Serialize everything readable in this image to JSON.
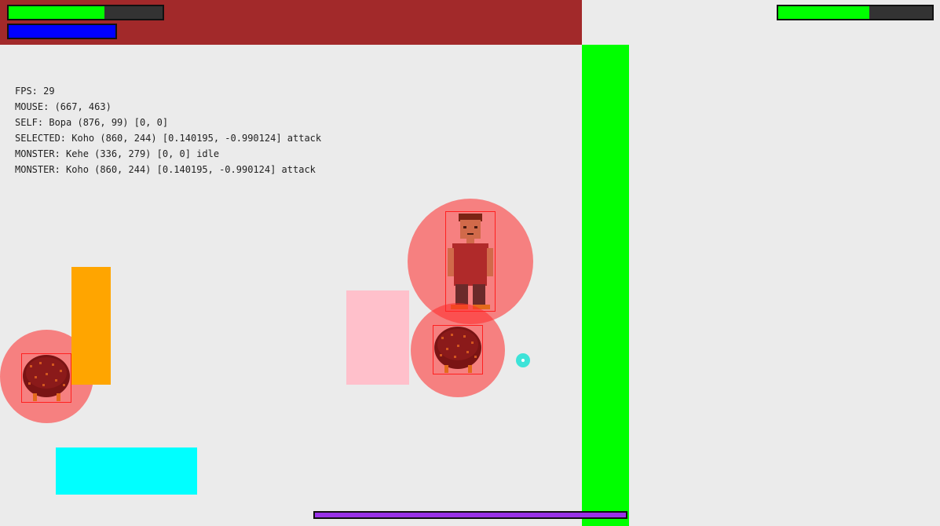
{
  "hud": {
    "player_health": 0.62,
    "player_mana": 1.0,
    "target_health": 0.59,
    "cast_progress": 1.0,
    "colors": {
      "banner": "#a2292a",
      "health": "#00ff00",
      "mana": "#0000ff",
      "cast": "#9932e8"
    }
  },
  "debug": {
    "fps": "FPS: 29",
    "mouse": "MOUSE: (667, 463)",
    "self": "SELF: Bopa (876, 99) [0, 0]",
    "selected": "SELECTED: Koho (860, 244) [0.140195, -0.990124] attack",
    "monster1": "MONSTER: Kehe (336, 279) [0, 0] idle",
    "monster2": "MONSTER: Koho (860, 244) [0.140195, -0.990124] attack"
  },
  "entities": {
    "player_sprite": "player-character",
    "monster_sprite": "furry-monster"
  },
  "colors": {
    "wall": "#00ff00",
    "orange_block": "#ffa500",
    "pink_block": "#ffc0cb",
    "cyan_block": "#00ffff",
    "aura": "#ff2828"
  }
}
